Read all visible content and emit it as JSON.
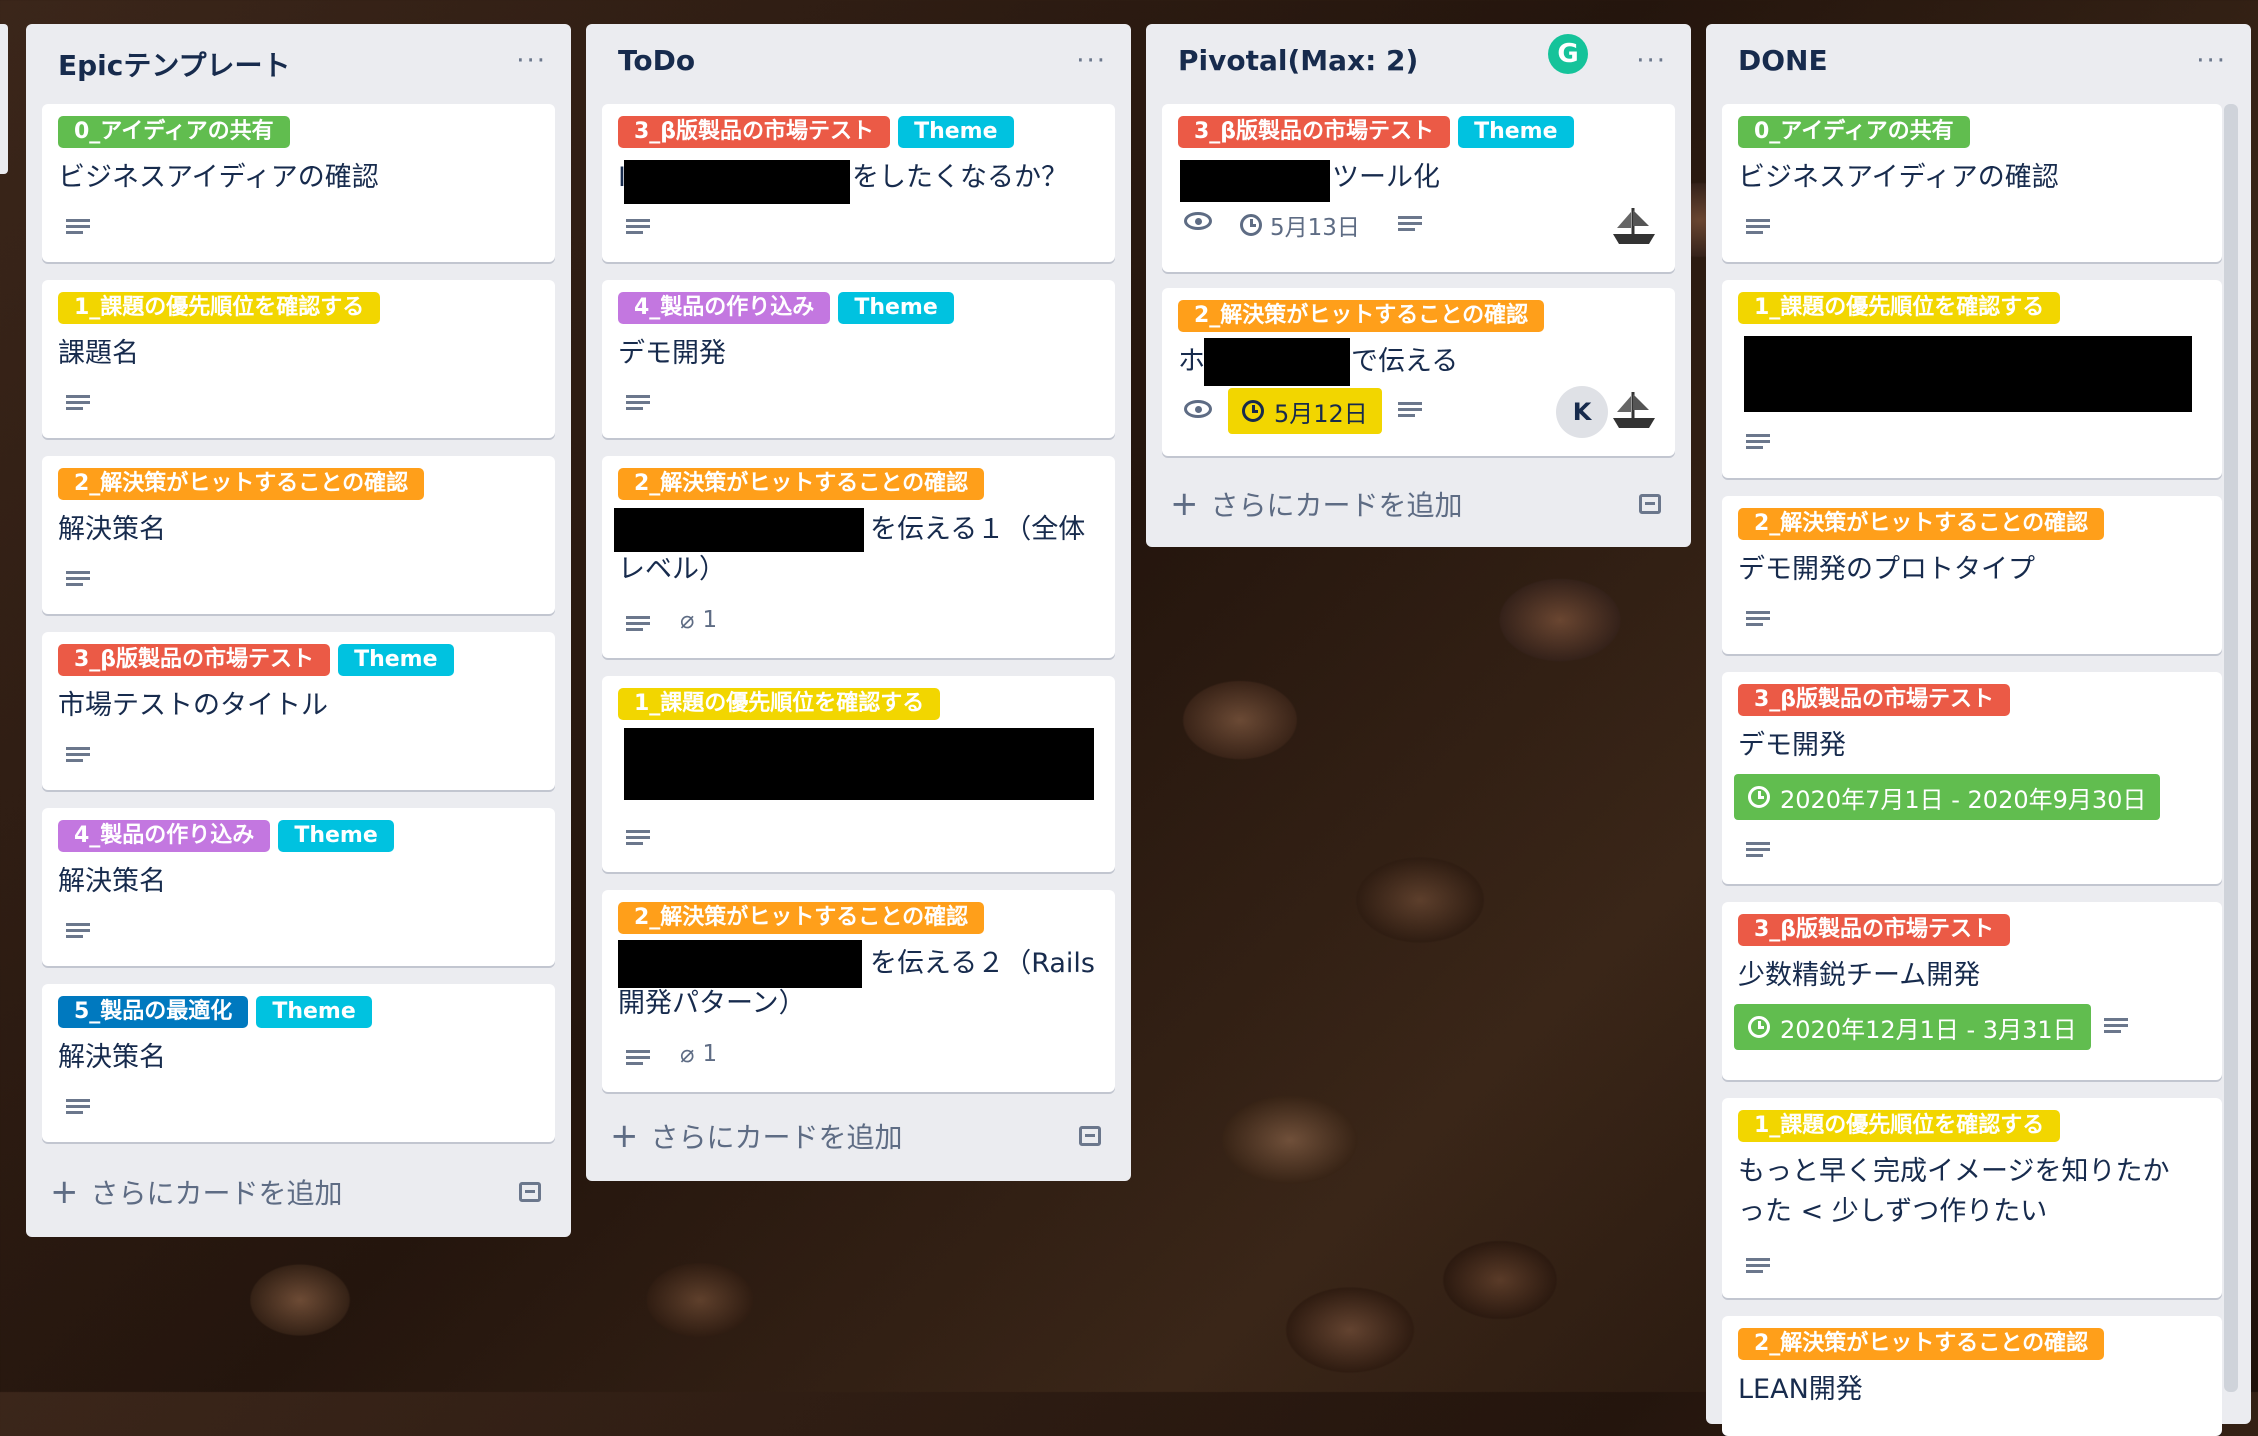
{
  "lists": [
    {
      "title": "Epicテンプレート",
      "menu": "···",
      "add_card": "さらにカードを追加",
      "cards": [
        {
          "labels": [
            "0_アイディアの共有"
          ],
          "title": "ビジネスアイディアの確認"
        },
        {
          "labels": [
            "1_課題の優先順位を確認する"
          ],
          "title": "課題名"
        },
        {
          "labels": [
            "2_解決策がヒットすることの確認"
          ],
          "title": "解決策名"
        },
        {
          "labels": [
            "3_β版製品の市場テスト",
            "Theme"
          ],
          "title": "市場テストのタイトル"
        },
        {
          "labels": [
            "4_製品の作り込み",
            "Theme"
          ],
          "title": "解決策名"
        },
        {
          "labels": [
            "5_製品の最適化",
            "Theme"
          ],
          "title": "解決策名"
        }
      ]
    },
    {
      "title": "ToDo",
      "menu": "···",
      "add_card": "さらにカードを追加",
      "cards": [
        {
          "labels": [
            "3_β版製品の市場テスト",
            "Theme"
          ],
          "title_prefix": "I",
          "title": "をしたくなるか？"
        },
        {
          "labels": [
            "4_製品の作り込み",
            "Theme"
          ],
          "title": "デモ開発"
        },
        {
          "labels": [
            "2_解決策がヒットすることの確認"
          ],
          "title_line1": "を伝える１（全体",
          "title_line2": "レベル）",
          "attachments": "1"
        },
        {
          "labels": [
            "1_課題の優先順位を確認する"
          ],
          "title": ""
        },
        {
          "labels": [
            "2_解決策がヒットすることの確認"
          ],
          "title_line1": "を伝える２（Rails",
          "title_line2": "開発パターン）",
          "attachments": "1"
        }
      ]
    },
    {
      "title": "Pivotal(Max: 2)",
      "menu": "···",
      "add_card": "さらにカードを追加",
      "grammarly": "G",
      "cards": [
        {
          "labels": [
            "3_β版製品の市場テスト",
            "Theme"
          ],
          "title": "ツール化",
          "due": "5月13日"
        },
        {
          "labels": [
            "2_解決策がヒットすることの確認"
          ],
          "title_prefix": "ホ",
          "title": "で伝える",
          "due": "5月12日",
          "member": "K"
        }
      ]
    },
    {
      "title": "DONE",
      "menu": "···",
      "cards": [
        {
          "labels": [
            "0_アイディアの共有"
          ],
          "title": "ビジネスアイディアの確認"
        },
        {
          "labels": [
            "1_課題の優先順位を確認する"
          ],
          "title": ""
        },
        {
          "labels": [
            "2_解決策がヒットすることの確認"
          ],
          "title": "デモ開発のプロトタイプ"
        },
        {
          "labels": [
            "3_β版製品の市場テスト"
          ],
          "title": "デモ開発",
          "dates": "2020年7月1日 - 2020年9月30日"
        },
        {
          "labels": [
            "3_β版製品の市場テスト"
          ],
          "title": "少数精鋭チーム開発",
          "dates": "2020年12月1日 - 3月31日"
        },
        {
          "labels": [
            "1_課題の優先順位を確認する"
          ],
          "title_line1": "もっと早く完成イメージを知りたか",
          "title_line2": "った < 少しずつ作りたい"
        },
        {
          "labels": [
            "2_解決策がヒットすることの確認"
          ],
          "title": "LEAN開発"
        }
      ]
    }
  ],
  "label_colors": {
    "green": "#61bd4f",
    "yellow": "#f2d600",
    "orange": "#ff9f1a",
    "red": "#eb5a46",
    "purple": "#c377e0",
    "blue": "#0079bf",
    "sky": "#00c2e0"
  },
  "icons": [
    "description-icon",
    "eye-icon",
    "clock-icon",
    "attachment-icon",
    "plus-icon",
    "card-template-icon",
    "ship-sticker-icon",
    "grammarly-icon"
  ]
}
